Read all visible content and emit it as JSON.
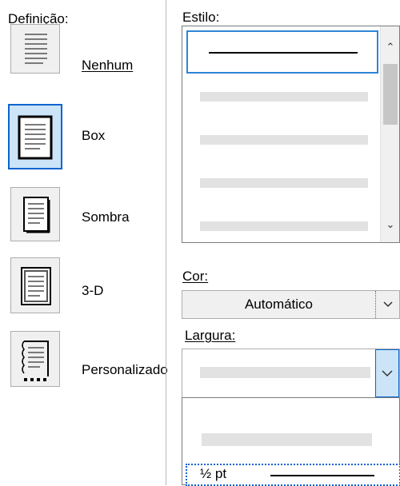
{
  "definition": {
    "heading": "Definição:",
    "presets": [
      {
        "label": "Nenhum",
        "mnemonic_index": 0
      },
      {
        "label": "Box",
        "mnemonic_index": 2
      },
      {
        "label": "Sombra",
        "mnemonic_index": 2
      },
      {
        "label": "3-D",
        "mnemonic_index": 2
      },
      {
        "label": "Personalizado",
        "mnemonic_index": 1
      }
    ],
    "selected_preset": "Box"
  },
  "style": {
    "heading": "Estilo:"
  },
  "color": {
    "heading": "Cor:",
    "value": "Automático"
  },
  "width": {
    "heading": "Largura:",
    "list_item_label": "½ pt"
  },
  "colors": {
    "accent": "#0a64d0",
    "selected_bg": "#cce4f7",
    "placeholder_bar": "#e2e2e2"
  }
}
